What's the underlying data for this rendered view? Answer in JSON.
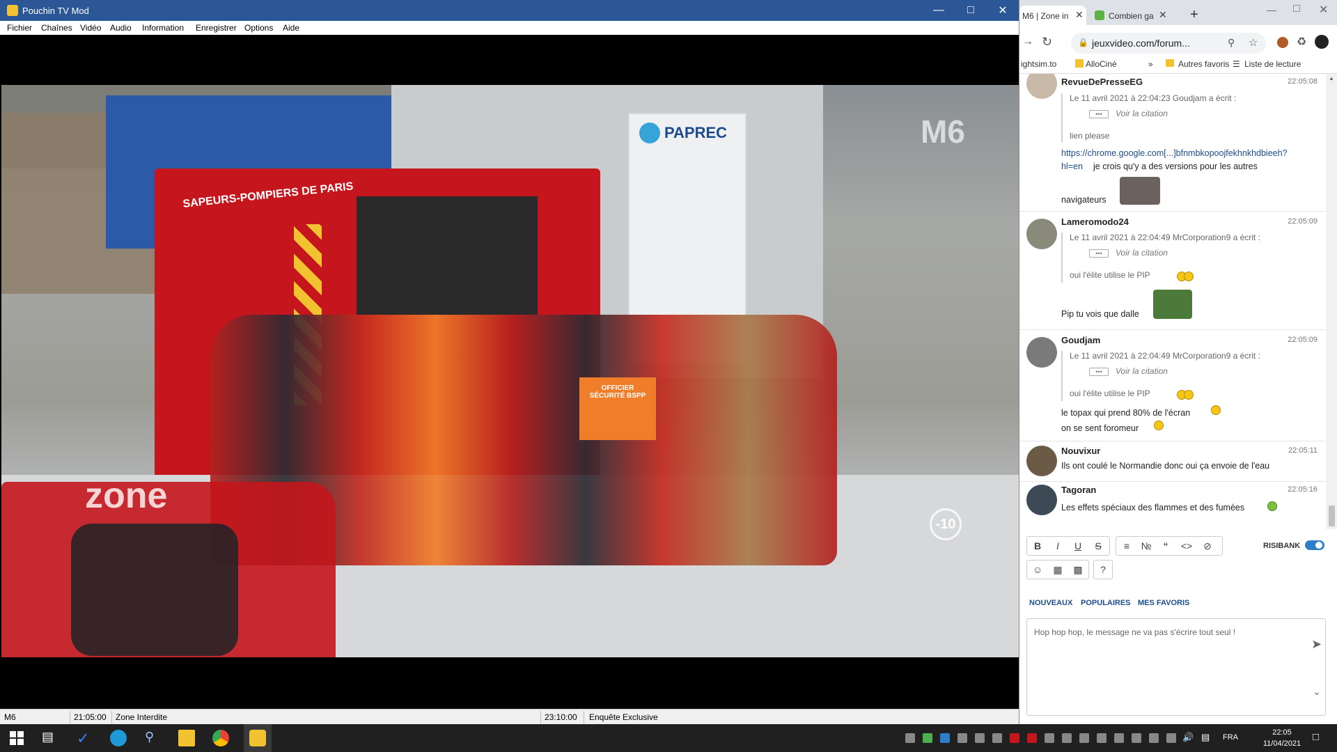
{
  "tv": {
    "title": "Pouchin TV Mod",
    "menu": [
      "Fichier",
      "Chaînes",
      "Vidéo",
      "Audio",
      "Information",
      "Enregistrer",
      "Options",
      "Aide"
    ],
    "video": {
      "channel_logo": "M6",
      "watermark": "zone",
      "age_badge": "-10",
      "truck_text": "SAPEURS-POMPIERS DE PARIS",
      "sign_text": "PAPREC",
      "vest_text": "OFFICIER SÉCURITÉ BSPP"
    },
    "status": {
      "channel": "M6",
      "start_time": "21:05:00",
      "program": "Zone Interdite",
      "next_time": "23:10:00",
      "next_program": "Enquête Exclusive"
    }
  },
  "browser": {
    "tabs": [
      {
        "label": "M6 | Zone in",
        "active": true
      },
      {
        "label": "Combien ga",
        "active": false
      }
    ],
    "new_tab": "+",
    "address": "jeuxvideo.com/forum...",
    "bookmarks": [
      "ightsim.to",
      "AlloCiné",
      "»",
      "Autres favoris",
      "Liste de lecture"
    ]
  },
  "forum": {
    "posts": [
      {
        "author": "RevueDePresseEG",
        "time": "22:05:08",
        "quote_header": "Le 11 avril 2021 à 22:04:23 Goudjam a écrit :",
        "quote_view": "Voir la citation",
        "quote_tail": "lien please",
        "link": "https://chrome.google.com[...]bfnmbkopoojfekhnkhdbieeh?",
        "link2": "hl=en",
        "message": "je crois qu'y a des versions pour les autres",
        "message2": "navigateurs"
      },
      {
        "author": "Lameromodo24",
        "time": "22:05:09",
        "quote_header": "Le 11 avril 2021 à 22:04:49 MrCorporation9 a écrit :",
        "quote_view": "Voir la citation",
        "quote_tail": "oui l'élite utilise le PIP",
        "message": "Pip tu vois que dalle"
      },
      {
        "author": "Goudjam",
        "time": "22:05:09",
        "quote_header": "Le 11 avril 2021 à 22:04:49 MrCorporation9 a écrit :",
        "quote_view": "Voir la citation",
        "quote_tail": "oui l'élite utilise le PIP",
        "message": "le topax qui prend 80% de l'écran",
        "message2": "on se sent foromeur"
      },
      {
        "author": "Nouvixur",
        "time": "22:05:11",
        "message": "Ils ont coulé le Normandie donc oui ça envoie de l'eau"
      },
      {
        "author": "Tagoran",
        "time": "22:05:16",
        "message": "Les effets spéciaux des flammes et des fumées"
      }
    ],
    "editor": {
      "risibank_label": "RISIBANK",
      "sticker_tabs": [
        "NOUVEAUX",
        "POPULAIRES",
        "MES FAVORIS"
      ],
      "placeholder": "Hop hop hop, le message ne va pas s'écrire tout seul !"
    }
  },
  "taskbar": {
    "language": "FRA",
    "time": "22:05",
    "date": "11/04/2021"
  },
  "colors": {
    "titlebar": "#2b5797",
    "truck_red": "#c4161c",
    "link": "#1d4c8c"
  }
}
